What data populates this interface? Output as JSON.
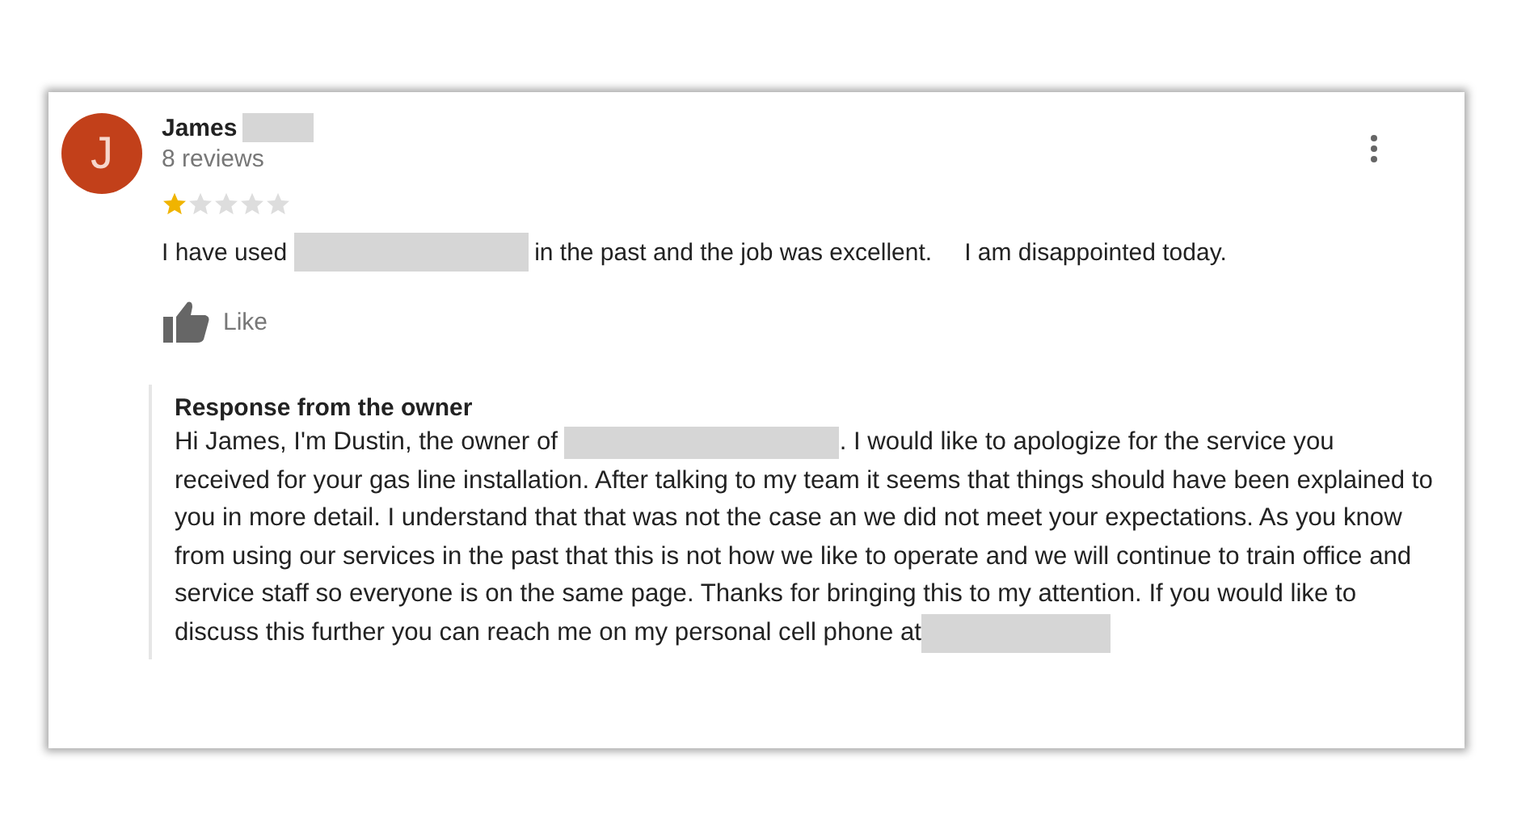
{
  "review": {
    "avatar_letter": "J",
    "author": {
      "first_name": "James",
      "surname_redacted": true
    },
    "review_count": "8 reviews",
    "stars": 1,
    "text": [
      {
        "kind": "text",
        "text": "I have used"
      },
      {
        "kind": "redacted"
      },
      {
        "kind": "text",
        "text": "in the past and the job was excellent."
      },
      {
        "kind": "text",
        "text": "I am disappointed today."
      }
    ],
    "like": {
      "label": "Like"
    },
    "owner_response": {
      "title": "Response from the owner",
      "text": [
        {
          "kind": "text",
          "text": "Hi James, I'm Dustin, the owner of "
        },
        {
          "kind": "redacted"
        },
        {
          "kind": "text",
          "text": ". I would like to apologize for the service you received for your gas line installation. After talking to my team it seems that things should have been explained to you in more detail. I understand that that was not the case an we did not meet your expectations. As you know from using our services in the past that this is not how we like to operate and we will continue to train office and service staff so everyone is on the same page. Thanks for bringing this to my attention. If you would like to discuss this further you can reach me on my personal cell phone at"
        },
        {
          "kind": "redacted"
        }
      ]
    }
  }
}
